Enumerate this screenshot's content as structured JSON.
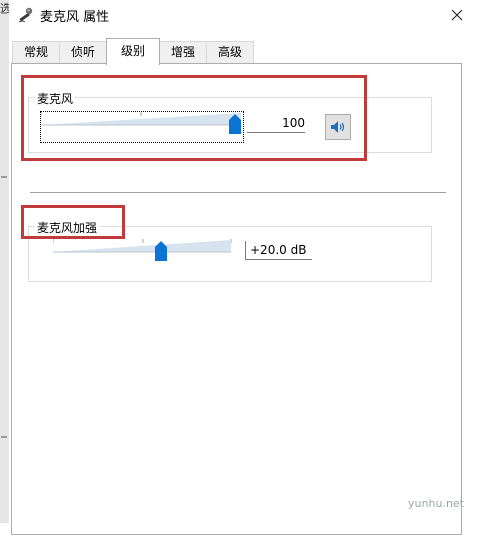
{
  "window": {
    "title": "麦克风 属性"
  },
  "tabs": [
    {
      "label": "常规",
      "active": false
    },
    {
      "label": "侦听",
      "active": false
    },
    {
      "label": "级别",
      "active": true
    },
    {
      "label": "增强",
      "active": false
    },
    {
      "label": "高级",
      "active": false
    }
  ],
  "microphone": {
    "label": "麦克风",
    "level": 100,
    "value_text": "100",
    "mute_button_icon": "speaker-icon"
  },
  "boost": {
    "label": "麦克风加强",
    "level_fraction": 0.61,
    "value_text": "+20.0 dB"
  },
  "annotation_color": "#c23b3b",
  "accent_color": "#0a74d4",
  "watermark": "yunhu.net"
}
